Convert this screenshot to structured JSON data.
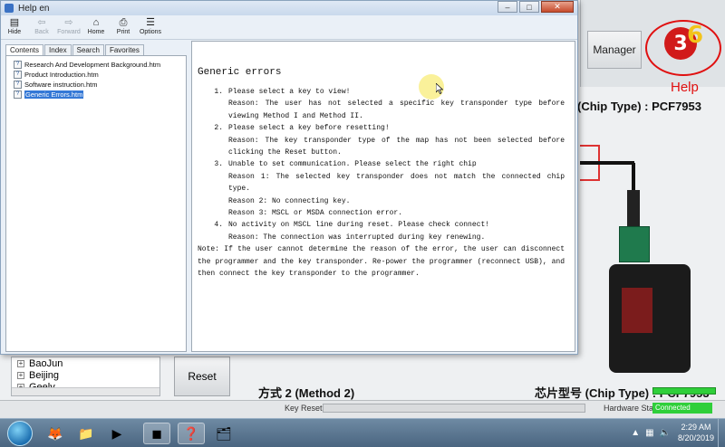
{
  "background_app": {
    "manager_label": "Manager",
    "help_label": "Help",
    "logo_text": "3",
    "logo_six": "6",
    "chip_type_top": "(Chip Type) : PCF7953",
    "chip_type_bottom": "芯片型号 (Chip Type) : PCF7953",
    "method2_label": "方式 2 (Method 2)",
    "reset_label": "Reset",
    "brands": [
      "BaoJun",
      "Beijing",
      "Geely"
    ],
    "key_reset_label": "Key Reset:",
    "hardware_state_label": "Hardware State:",
    "hardware_state_value": "Connected"
  },
  "help_window": {
    "title": "Help en",
    "window_buttons": {
      "minimize": "–",
      "maximize": "□",
      "close": "✕"
    },
    "toolbar": [
      {
        "label": "Hide",
        "icon": "hide-icon",
        "enabled": true
      },
      {
        "label": "Back",
        "icon": "back-arrow-icon",
        "enabled": false
      },
      {
        "label": "Forward",
        "icon": "forward-arrow-icon",
        "enabled": false
      },
      {
        "label": "Home",
        "icon": "home-icon",
        "enabled": true
      },
      {
        "label": "Print",
        "icon": "print-icon",
        "enabled": true
      },
      {
        "label": "Options",
        "icon": "options-icon",
        "enabled": true
      }
    ],
    "tabs": [
      "Contents",
      "Index",
      "Search",
      "Favorites"
    ],
    "active_tab": "Contents",
    "toc": [
      {
        "label": "Research And Development Background.htm",
        "selected": false
      },
      {
        "label": "Product Introduction.htm",
        "selected": false
      },
      {
        "label": "Software instruction.htm",
        "selected": false
      },
      {
        "label": "Generic Errors.htm",
        "selected": true
      }
    ],
    "document": {
      "heading": "Generic errors",
      "items": [
        {
          "num": "1.",
          "text": "Please select a key to view!",
          "reasons": [
            "Reason: The user has not selected a specific key transponder type before viewing Method I and Method II."
          ]
        },
        {
          "num": "2.",
          "text": "Please select a key before resetting!",
          "reasons": [
            "Reason: The key transponder type of the map has not been selected before clicking the Reset button."
          ]
        },
        {
          "num": "3.",
          "text": "Unable to set communication. Please select the right chip",
          "reasons": [
            "Reason 1: The selected key transponder does not match the connected chip type.",
            "Reason 2: No connecting key.",
            "Reason 3: MSCL or MSDA connection error."
          ]
        },
        {
          "num": "4.",
          "text": "No activity on MSCL line during reset. Please check connect!",
          "reasons": [
            "Reason: The connection was interrupted during key renewing."
          ]
        }
      ],
      "note": "Note: If the user cannot determine the reason of the error, the user can disconnect the programmer and the key transponder. Re-power the programmer (reconnect USB), and then connect the key transponder to the programmer."
    }
  },
  "taskbar": {
    "apps": [
      {
        "icon": "firefox-icon",
        "glyph": "🦊",
        "active": false
      },
      {
        "icon": "folder-icon",
        "glyph": "📁",
        "active": false
      },
      {
        "icon": "media-player-icon",
        "glyph": "▶",
        "active": false
      },
      {
        "icon": "programmer-app-icon",
        "glyph": "◼",
        "active": true
      },
      {
        "icon": "help-window-icon",
        "glyph": "❓",
        "active": true
      },
      {
        "icon": "app-icon-6",
        "glyph": "🗂",
        "active": false
      }
    ],
    "clock_time": "2:29 AM",
    "clock_date": "8/20/2019"
  },
  "colors": {
    "help_red": "#e01010",
    "connected_green": "#2fcf3a",
    "selection_blue": "#3478d6"
  }
}
